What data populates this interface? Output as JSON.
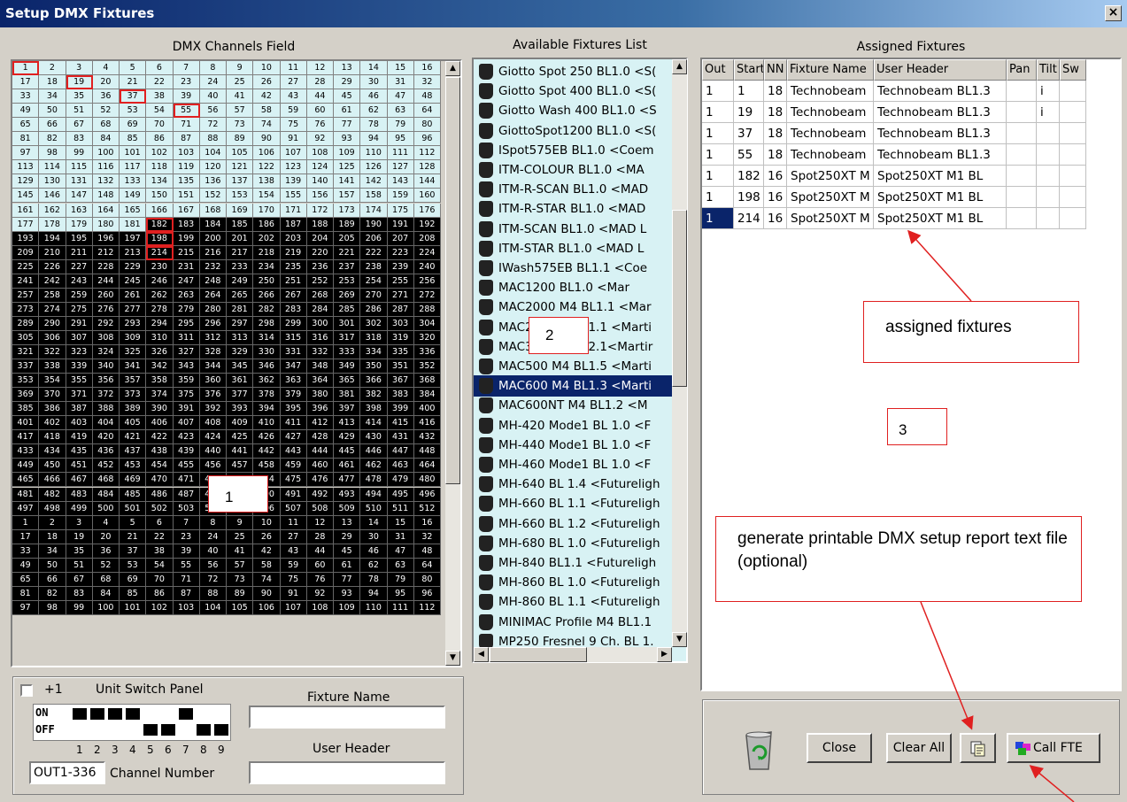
{
  "window": {
    "title": "Setup DMX Fixtures",
    "close": "×"
  },
  "headers": {
    "dmx": "DMX Channels Field",
    "available": "Available Fixtures List",
    "assigned": "Assigned Fixtures"
  },
  "dmx": {
    "free_until": 80,
    "black_regions": [
      [
        81,
        512
      ],
      [
        1,
        112
      ]
    ],
    "starts": [
      1,
      19,
      37,
      55,
      182,
      198,
      214
    ],
    "free_extra": [
      81,
      82,
      83,
      84,
      85,
      86,
      87,
      88,
      89,
      90,
      91,
      92,
      93,
      94,
      95,
      96,
      97,
      98,
      99,
      100,
      101,
      102,
      103,
      104,
      105,
      106,
      107,
      108,
      109,
      110,
      111,
      112,
      113,
      114,
      115,
      116,
      117,
      118,
      119,
      120,
      121,
      122,
      123,
      124,
      125,
      126,
      127,
      128,
      129,
      130,
      131,
      132,
      133,
      134,
      135,
      136,
      137,
      138,
      139,
      140,
      141,
      142,
      143,
      144,
      145,
      146,
      147,
      148,
      149,
      150,
      151,
      152,
      153,
      154,
      155,
      156,
      157,
      158,
      159,
      160,
      161,
      162,
      163,
      164,
      165,
      166,
      167,
      168,
      169,
      170,
      171,
      172,
      173,
      174,
      175,
      176,
      177,
      178,
      179,
      180,
      181,
      182,
      183,
      184,
      185,
      186,
      187,
      188,
      189,
      190,
      191,
      192,
      193,
      194,
      195,
      196,
      197,
      198,
      199,
      200,
      201,
      202,
      203,
      204,
      205,
      206,
      207,
      208,
      209,
      210,
      211,
      212,
      213,
      214,
      215,
      216,
      217,
      218,
      219,
      220,
      221,
      222,
      223,
      224,
      225,
      226,
      227,
      228,
      229
    ]
  },
  "fixtures": [
    "Giotto Spot 250 BL1.0 <S(",
    "Giotto Spot 400 BL1.0 <S(",
    "Giotto Wash 400 BL1.0 <S",
    "GiottoSpot1200 BL1.0 <S(",
    "ISpot575EB BL1.0 <Coem",
    "ITM-COLOUR BL1.0 <MA",
    "ITM-R-SCAN BL1.0 <MAD",
    "ITM-R-STAR BL1.0 <MAD",
    "ITM-SCAN BL1.0 <MAD L",
    "ITM-STAR BL1.0 <MAD L",
    "IWash575EB BL1.1 <Coe",
    "MAC1200 BL1.0 <Mar",
    "MAC2000 M4 BL1.1 <Mar",
    "MAC250 M4 BL1.1 <Marti",
    "MAC300 M4 BL2.1<Martir",
    "MAC500 M4 BL1.5 <Marti",
    "MAC600 M4 BL1.3 <Marti",
    "MAC600NT M4 BL1.2 <M",
    "MH-420 Mode1 BL 1.0 <F",
    "MH-440 Mode1 BL 1.0 <F",
    "MH-460 Mode1 BL 1.0 <F",
    "MH-640 BL 1.4 <Futureligh",
    "MH-660 BL 1.1 <Futureligh",
    "MH-660 BL 1.2 <Futureligh",
    "MH-680 BL 1.0 <Futureligh",
    "MH-840 BL1.1 <Futureligh",
    "MH-860 BL 1.0 <Futureligh",
    "MH-860 BL 1.1 <Futureligh",
    "MINIMAC Profile M4 BL1.1",
    "MP250 Fresnel 9 Ch. BL 1."
  ],
  "selected_fixture": 16,
  "assigned": {
    "columns": [
      "Out",
      "Start",
      "NN",
      "Fixture Name",
      "User Header",
      "Pan",
      "Tilt",
      "Sw"
    ],
    "rows": [
      [
        "1",
        "1",
        "18",
        "Technobeam",
        "Technobeam BL1.3",
        "",
        "i",
        ""
      ],
      [
        "1",
        "19",
        "18",
        "Technobeam",
        "Technobeam BL1.3",
        "",
        "i",
        ""
      ],
      [
        "1",
        "37",
        "18",
        "Technobeam",
        "Technobeam BL1.3",
        "",
        "",
        ""
      ],
      [
        "1",
        "55",
        "18",
        "Technobeam",
        "Technobeam BL1.3",
        "",
        "",
        ""
      ],
      [
        "1",
        "182",
        "16",
        "Spot250XT M",
        "Spot250XT M1 BL",
        "",
        "",
        ""
      ],
      [
        "1",
        "198",
        "16",
        "Spot250XT M",
        "Spot250XT M1 BL",
        "",
        "",
        ""
      ],
      [
        "1",
        "214",
        "16",
        "Spot250XT M",
        "Spot250XT M1 BL",
        "",
        "",
        ""
      ]
    ],
    "selected_row": 6
  },
  "switch_panel": {
    "plus_one": "+1",
    "title": "Unit Switch Panel",
    "on": "ON",
    "off": "OFF",
    "numbers": [
      "1",
      "2",
      "3",
      "4",
      "5",
      "6",
      "7",
      "8",
      "9"
    ],
    "on_states": [
      true,
      true,
      true,
      true,
      false,
      false,
      true,
      false,
      false
    ],
    "channel_value": "OUT1-336",
    "channel_label": "Channel Number"
  },
  "fields": {
    "fixture_name_label": "Fixture Name",
    "user_header_label": "User Header",
    "fixture_name": "",
    "user_header": ""
  },
  "buttons": {
    "close": "Close",
    "clear_all": "Clear All",
    "call_fte": "Call FTE"
  },
  "annotations": {
    "n1": "1",
    "n2": "2",
    "n3": "3",
    "assigned_note": "assigned fixtures",
    "report_note": "generate printable DMX setup report text file (optional)"
  }
}
